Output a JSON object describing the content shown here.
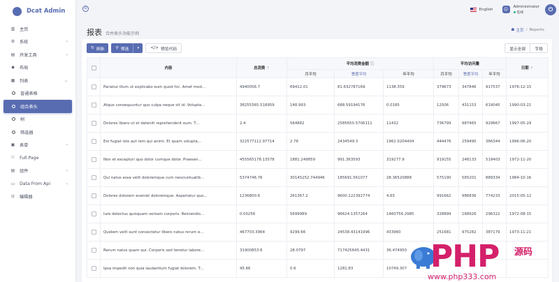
{
  "app": {
    "title": "Dcat Admin"
  },
  "sidebar": {
    "items": [
      {
        "icon": "▥",
        "label": "主页",
        "chevron": ""
      },
      {
        "icon": "⚙",
        "label": "系统",
        "chevron": "‹"
      },
      {
        "icon": "▤",
        "label": "开发工具",
        "chevron": "‹"
      },
      {
        "icon": "◆",
        "label": "布局",
        "chevron": ""
      },
      {
        "icon": "▦",
        "label": "列表",
        "chevron": "⌄"
      },
      {
        "icon": "",
        "label": "普通表格",
        "chevron": "",
        "sub": true
      },
      {
        "icon": "",
        "label": "组合表头",
        "chevron": "",
        "sub": true,
        "active": true
      },
      {
        "icon": "",
        "label": "树",
        "chevron": "",
        "sub": true
      },
      {
        "icon": "",
        "label": "筛选器",
        "chevron": "",
        "sub": true
      },
      {
        "icon": "▣",
        "label": "表单",
        "chevron": "‹"
      },
      {
        "icon": "⤫",
        "label": "Full Page",
        "chevron": ""
      },
      {
        "icon": "▤",
        "label": "组件",
        "chevron": "‹"
      },
      {
        "icon": "▭",
        "label": "Data From Api",
        "chevron": "‹"
      },
      {
        "icon": "U",
        "label": "编辑器",
        "chevron": ""
      }
    ]
  },
  "navbar": {
    "language": "English",
    "user_name": "Administrator",
    "user_status": "在线"
  },
  "page": {
    "title": "报表",
    "subtitle": "合并表头功能示例",
    "breadcrumb_home": "主页",
    "breadcrumb_current": "Reports"
  },
  "toolbar": {
    "refresh_label": "刷新",
    "filter_label": "筛选",
    "export_label": "预览代码",
    "show_all_label": "显示全部",
    "columns_label": "字段"
  },
  "table": {
    "headers": {
      "content": "内容",
      "total": "总消费",
      "avg_amount": "平均消费金额",
      "avg_visits": "平均访问量",
      "date": "日期",
      "month_avg": "月平均",
      "quarter_avg": "季度平均",
      "year_avg": "年平均"
    },
    "rows": [
      [
        "Pariatur illum ut explicabo eum quod hic. Amet mod...",
        "4940056.7",
        "69412.01",
        "81.632787169",
        "1138.359",
        "379673",
        "347846",
        "917537",
        "1976-12-15"
      ],
      [
        "Atque consequuntur quo culpa neque sit id. Volupta...",
        "38255365.518959",
        "148.993",
        "688.59194176",
        "0.0185",
        "12506",
        "431153",
        "619045",
        "1990-03-21"
      ],
      [
        "Dolores libero ut et deleniti reprehenderit eum. T...",
        "2.4",
        "564882",
        "2585650.5706111",
        "11432",
        "736799",
        "987465",
        "929667",
        "1997-05-29"
      ],
      [
        "Est fugiat iste aut rem qui animi. Et quam volupta...",
        "322577112.97714",
        "2.76",
        "2434549.3",
        "1962.0204404",
        "444476",
        "259490",
        "366344",
        "1996-06-20"
      ],
      [
        "Non et excepturi quo dolor cumque dolor. Praesen...",
        "455565178.13578",
        "1881.249859",
        "991.363593",
        "319277.9",
        "919155",
        "248133",
        "519403",
        "1972-11-20"
      ],
      [
        "Qui natus esse velit doloremque cum nesciuntuatib...",
        "5374746.76",
        "30145252.744946",
        "185691.561077",
        "28.36520888",
        "575190",
        "565201",
        "889334",
        "1984-10-16"
      ],
      [
        "Dolores dolorem eveniet doloremque. Asperiatur quo...",
        "1236800.6",
        "261367.2",
        "9600.122392774",
        "4.65",
        "991662",
        "986836",
        "774233",
        "2015-05-12"
      ],
      [
        "Iure delectus quisquam veniam corporis. Reiciendis...",
        "0.00256",
        "5699989",
        "96624.1357264",
        "1460756.2985",
        "328899",
        "168926",
        "296322",
        "1972-08-15"
      ],
      [
        "Quidem velit sunt consectetur libero natus rerum e...",
        "467703.3964",
        "9299.66",
        "24538.43141996",
        "433960",
        "251681",
        "975282",
        "387179",
        "1973-11-21"
      ],
      [
        "Rerum natus quam qui. Corporis sed tenetur labore...",
        "31900853.6",
        "28.0797",
        "717425645.4431",
        "36.474950",
        "",
        "",
        "",
        ""
      ],
      [
        "Ipsa impedit non quia laudantium fugiat dolorem. T...",
        "45.66",
        "0.6",
        "1281.83",
        "10749.307",
        "",
        "",
        "",
        ""
      ]
    ]
  },
  "watermark": {
    "brand": "PHP",
    "suffix": "源码",
    "url": "www.php333.com"
  },
  "colors": {
    "accent": "#586cb1",
    "watermark": "#d4206a"
  }
}
